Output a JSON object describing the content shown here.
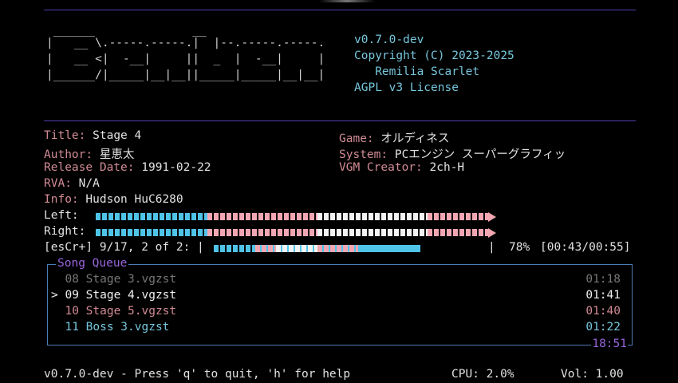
{
  "app": {
    "logo_lines": [
      " ______              __",
      "|   __ \\.-----.-----.|  |--.-----.-----.",
      "|   __ <|  -__|     ||  _  |  -__|     |",
      "|______/|_____|__|__||_____|_____|__|__|"
    ],
    "version": "v0.7.0-dev",
    "copyright": "Copyright (C) 2023-2025",
    "author_name": "   Remilia Scarlet",
    "license": "AGPL v3 License"
  },
  "track": {
    "title_label": "Title:",
    "title": "Stage 4",
    "author_label": "Author:",
    "author": "星恵太",
    "release_label": "Release Date:",
    "release": "1991-02-22",
    "rva_label": "RVA:",
    "rva": "N/A",
    "info_label": "Info:",
    "info": "Hudson HuC6280",
    "game_label": "Game:",
    "game": "オルディネス",
    "system_label": "System:",
    "system": "PCエンジン スーパーグラフィッ",
    "creator_label": "VGM Creator:",
    "creator": "2ch-H"
  },
  "meters": {
    "left_label": "Left:",
    "left_level": 1.0,
    "right_label": "Right:",
    "right_level": 1.0
  },
  "playback": {
    "status_prefix": "[esCr+] 9/17, 2 of 2: |",
    "progress": 0.78,
    "bar_end": "|",
    "percent": "78%",
    "time": "[00:43/00:55]",
    "colors": {
      "cyan": "#4fc3e8",
      "pink": "#f2a6b2",
      "white": "#f2f2f2"
    }
  },
  "queue": {
    "title": "Song Queue",
    "total": "18:51",
    "items": [
      {
        "text": "  08 Stage 3.vgzst",
        "duration": "01:18",
        "state": "played"
      },
      {
        "text": "> 09 Stage 4.vgzst",
        "duration": "01:41",
        "state": "current"
      },
      {
        "text": "  10 Stage 5.vgzst",
        "duration": "01:40",
        "state": "next"
      },
      {
        "text": "  11 Boss 3.vgzst",
        "duration": "01:22",
        "state": "upcoming"
      }
    ]
  },
  "footer": {
    "help": "v0.7.0-dev - Press 'q' to quit, 'h' for help",
    "cpu": "CPU: 2.0%",
    "vol": "Vol: 1.00"
  }
}
